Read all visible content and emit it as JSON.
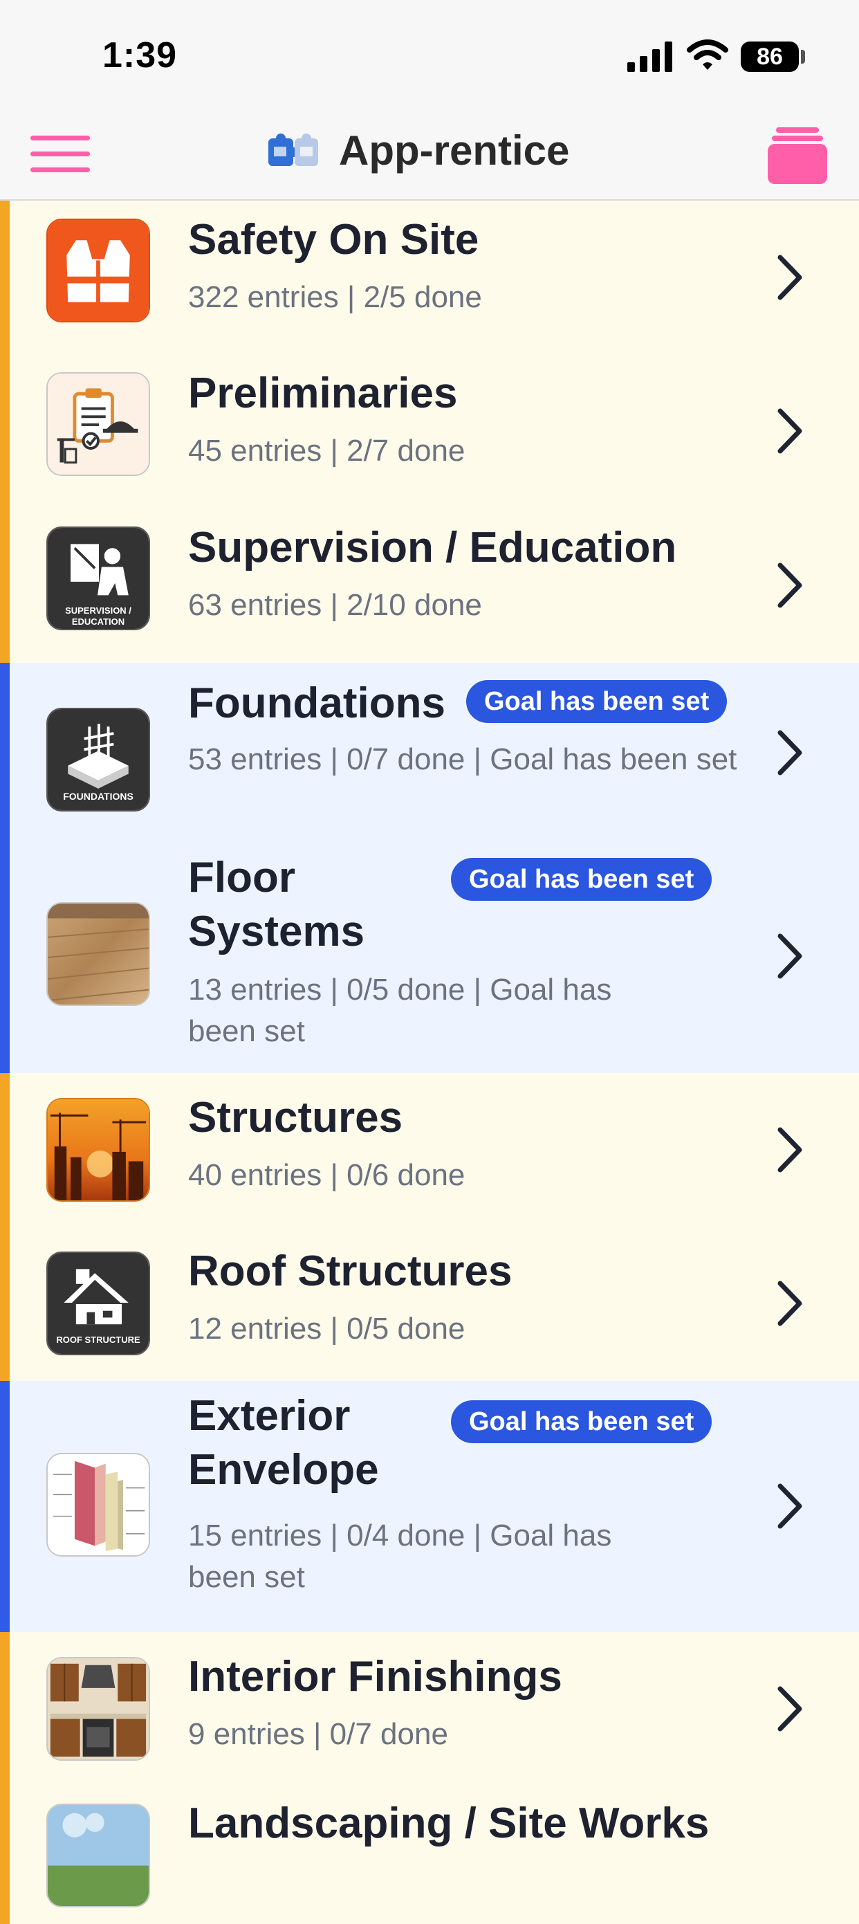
{
  "status_bar": {
    "time": "1:39",
    "battery": "86",
    "icons": [
      "signal-icon",
      "wifi-icon",
      "battery-icon"
    ]
  },
  "header": {
    "title": "App-rentice",
    "menu_icon": "hamburger-menu-icon",
    "logo_icon": "puzzle-logo-icon",
    "right_icon": "stack-icon"
  },
  "colors": {
    "accent_pink": "#ff5fa8",
    "yellow_row": "#fffbea",
    "blue_row": "#eef4ff",
    "yellow_accent": "#f5a524",
    "blue_accent": "#2f5be8",
    "badge_blue": "#2a56e0"
  },
  "categories": [
    {
      "title": "Safety On Site",
      "subtitle": "322 entries | 2/5 done",
      "style": "yellow",
      "icon": "safety-vest-icon"
    },
    {
      "title": "Preliminaries",
      "subtitle": "45 entries | 2/7 done",
      "style": "yellow",
      "icon": "clipboard-hardhat-icon"
    },
    {
      "title": "Supervision / Education",
      "subtitle": "63 entries | 2/10 done",
      "style": "yellow",
      "icon": "supervision-education-icon",
      "icon_caption": "SUPERVISION / EDUCATION"
    },
    {
      "title": "Foundations",
      "subtitle": "53 entries | 0/7 done | Goal has been set",
      "style": "blue",
      "badge": "Goal has been set",
      "icon": "foundations-icon",
      "icon_caption": "FOUNDATIONS"
    },
    {
      "title": "Floor Systems",
      "subtitle": "13 entries | 0/5 done | Goal has been set",
      "style": "blue",
      "badge": "Goal has been set",
      "icon": "wood-floor-photo"
    },
    {
      "title": "Structures",
      "subtitle": "40 entries | 0/6 done",
      "style": "yellow",
      "icon": "construction-sunset-photo"
    },
    {
      "title": "Roof Structures",
      "subtitle": "12 entries | 0/5 done",
      "style": "yellow",
      "icon": "roof-structure-icon",
      "icon_caption": "ROOF STRUCTURE"
    },
    {
      "title": "Exterior Envelope",
      "subtitle": "15 entries | 0/4 done | Goal has been set",
      "style": "blue",
      "badge": "Goal has been set",
      "icon": "wall-section-diagram"
    },
    {
      "title": "Interior Finishings",
      "subtitle": "9 entries | 0/7 done",
      "style": "yellow",
      "icon": "kitchen-photo"
    },
    {
      "title": "Landscaping / Site Works",
      "subtitle": "",
      "style": "yellow",
      "icon": "landscape-photo"
    }
  ]
}
